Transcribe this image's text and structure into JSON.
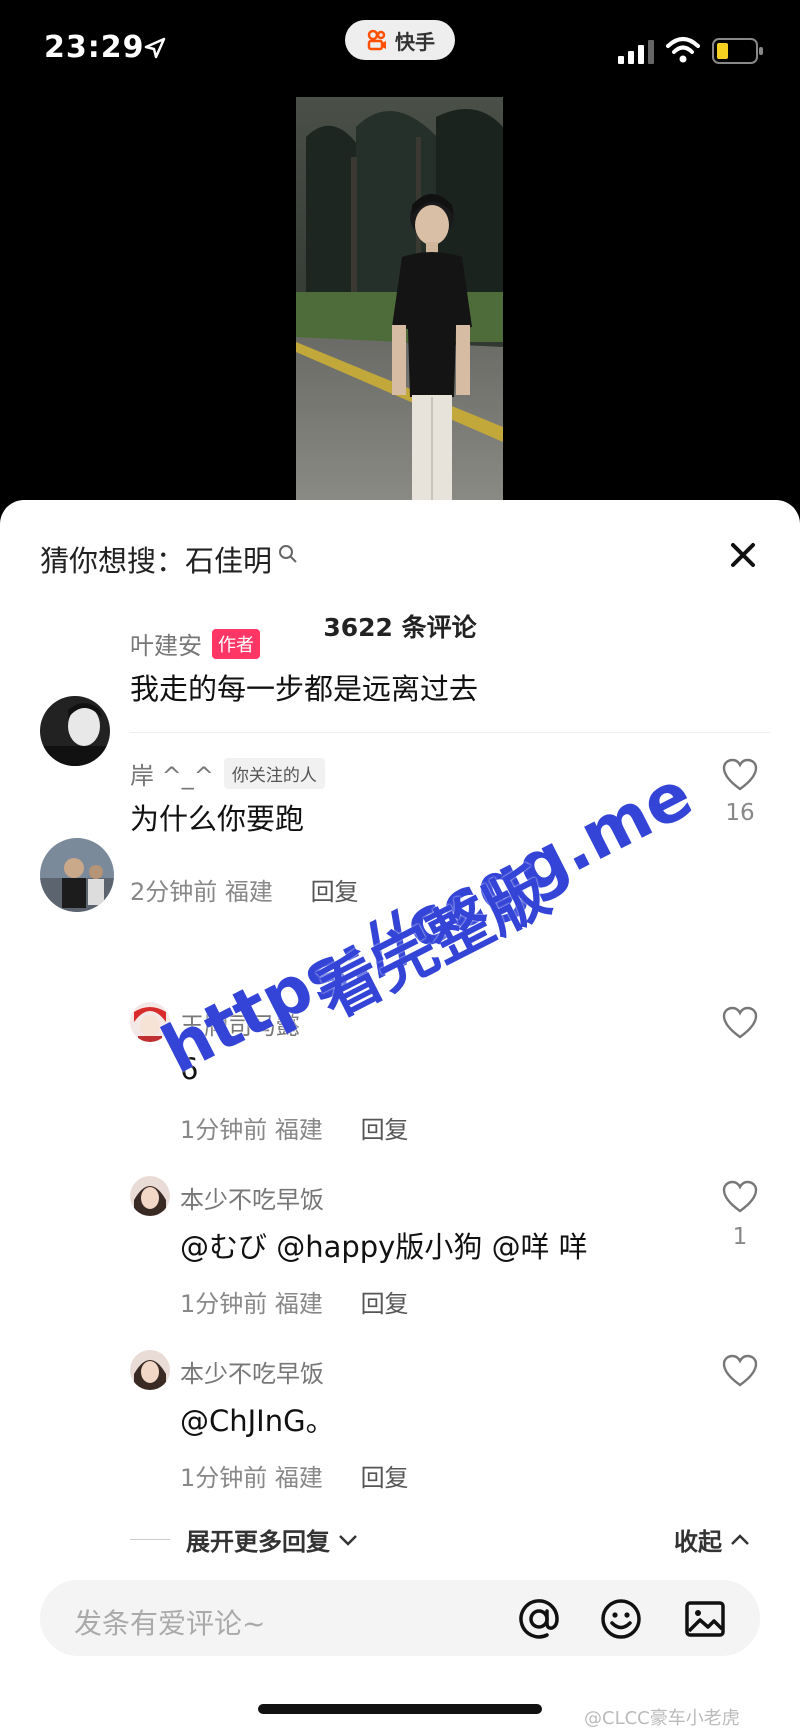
{
  "status_bar": {
    "time": "23:29",
    "app_name": "快手"
  },
  "search_suggestion": {
    "prefix": "猜你想搜：",
    "term": "石佳明"
  },
  "comments_count": "3622 条评论",
  "author_comment": {
    "name": "叶建安",
    "tag": "作者",
    "text": "我走的每一步都是远离过去"
  },
  "comment": {
    "name": "岸 ^_^",
    "tag": "你关注的人",
    "text": "为什么你要跑",
    "time": "2分钟前",
    "location": "福建",
    "reply": "回复",
    "likes": "16"
  },
  "replies": [
    {
      "name": "王牌司马懿",
      "text": "6",
      "time": "1分钟前",
      "location": "福建",
      "reply": "回复",
      "likes": ""
    },
    {
      "name": "本少不吃早饭",
      "text": "@むび @happy版小狗 @咩 咩",
      "time": "1分钟前",
      "location": "福建",
      "reply": "回复",
      "likes": "1"
    },
    {
      "name": "本少不吃早饭",
      "text": "@ChJInG。",
      "time": "1分钟前",
      "location": "福建",
      "reply": "回复",
      "likes": ""
    }
  ],
  "expand_more": "展开更多回复",
  "collapse": "收起",
  "input_placeholder": "发条有爱评论~",
  "watermark": {
    "url": "https://ccgg.me",
    "label": "看完整版"
  },
  "credit": "@CLCC豪车小老虎",
  "colors": {
    "accent": "#fe3666",
    "watermark": "#3344d6"
  }
}
